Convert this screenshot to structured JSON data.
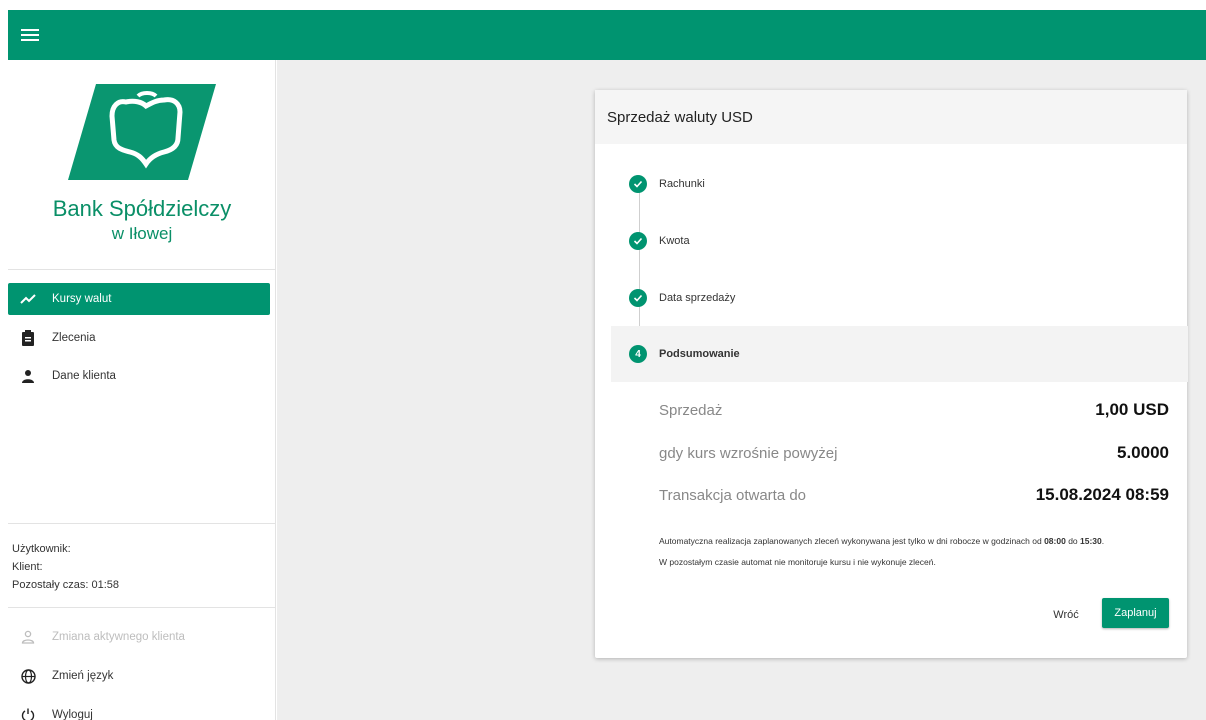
{
  "header": {
    "menu_icon": "menu-icon"
  },
  "bank": {
    "name_line1": "Bank Spółdzielczy",
    "name_line2": "w Iłowej"
  },
  "nav": [
    {
      "label": "Kursy walut",
      "icon": "trending-up-icon",
      "active": true
    },
    {
      "label": "Zlecenia",
      "icon": "clipboard-icon",
      "active": false
    },
    {
      "label": "Dane klienta",
      "icon": "person-icon",
      "active": false
    }
  ],
  "user": {
    "user_label": "Użytkownik:",
    "client_label": "Klient:",
    "time_label": "Pozostały czas: 01:58"
  },
  "footer_nav": [
    {
      "label": "Zmiana aktywnego klienta",
      "icon": "person-outline-icon",
      "disabled": true
    },
    {
      "label": "Zmień język",
      "icon": "globe-icon",
      "disabled": false
    },
    {
      "label": "Wyloguj",
      "icon": "power-icon",
      "disabled": false
    }
  ],
  "card": {
    "title": "Sprzedaż waluty USD",
    "steps": [
      {
        "label": "Rachunki",
        "state": "done"
      },
      {
        "label": "Kwota",
        "state": "done"
      },
      {
        "label": "Data sprzedaży",
        "state": "done"
      },
      {
        "label": "Podsumowanie",
        "state": "current",
        "number": "4"
      }
    ],
    "summary": [
      {
        "label": "Sprzedaż",
        "value": "1,00 USD"
      },
      {
        "label": "gdy kurs wzrośnie powyżej",
        "value": "5.0000"
      },
      {
        "label": "Transakcja otwarta do",
        "value": "15.08.2024 08:59"
      }
    ],
    "note_part1": "Automatyczna realizacja zaplanowanych zleceń wykonywana jest tylko w dni robocze w godzinach od ",
    "note_time_from": "08:00",
    "note_part2": " do ",
    "note_time_to": "15:30",
    "note_part3": ".",
    "note_line2": "W pozostałym czasie automat nie monitoruje kursu i nie wykonuje zleceń.",
    "back_label": "Wróć",
    "submit_label": "Zaplanuj"
  },
  "colors": {
    "brand": "#009470",
    "background": "#eeeeee"
  }
}
